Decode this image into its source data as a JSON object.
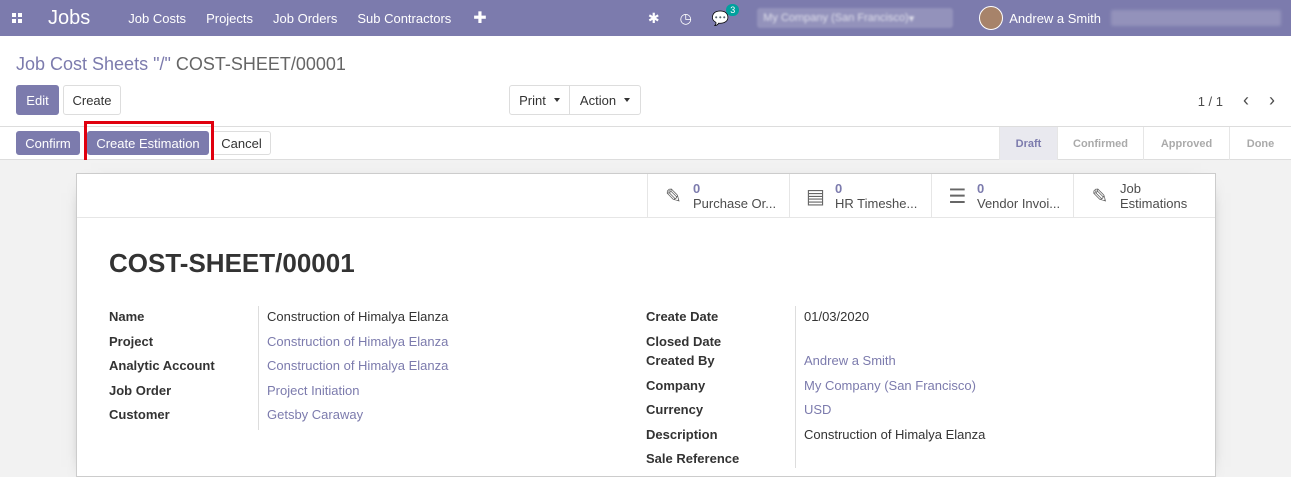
{
  "navbar": {
    "app_title": "Jobs",
    "menu": [
      "Job Costs",
      "Projects",
      "Job Orders",
      "Sub Contractors"
    ],
    "chat_count": "3",
    "company": "My Company (San Francisco)",
    "user": "Andrew a Smith"
  },
  "control": {
    "breadcrumb_parent": "Job Cost Sheets \"/\"",
    "breadcrumb_current": "COST-SHEET/00001",
    "edit_label": "Edit",
    "create_label": "Create",
    "print_label": "Print",
    "action_label": "Action",
    "pager": "1 / 1"
  },
  "statusbar": {
    "confirm_label": "Confirm",
    "create_estimation_label": "Create Estimation",
    "cancel_label": "Cancel",
    "stages": [
      "Draft",
      "Confirmed",
      "Approved",
      "Done"
    ],
    "current_stage": "Draft"
  },
  "smart_buttons": [
    {
      "value": "0",
      "label": "Purchase Or...",
      "icon": "edit-icon"
    },
    {
      "value": "0",
      "label": "HR Timeshe...",
      "icon": "book-icon"
    },
    {
      "value": "0",
      "label": "Vendor Invoi...",
      "icon": "list-icon"
    },
    {
      "value": "",
      "label": "Job Estimations",
      "icon": "edit-icon"
    }
  ],
  "sheet": {
    "title": "COST-SHEET/00001",
    "left_fields": [
      {
        "label": "Name",
        "value": "Construction of Himalya Elanza",
        "link": false
      },
      {
        "label": "Project",
        "value": "Construction of Himalya Elanza",
        "link": true
      },
      {
        "label": "Analytic Account",
        "value": "Construction of Himalya Elanza",
        "link": true
      },
      {
        "label": "Job Order",
        "value": "Project Initiation",
        "link": true
      },
      {
        "label": "Customer",
        "value": "Getsby Caraway",
        "link": true
      }
    ],
    "right_fields": [
      {
        "label": "Create Date",
        "value": "01/03/2020",
        "link": false
      },
      {
        "label": "Closed Date",
        "value": "",
        "link": false
      },
      {
        "label": "Created By",
        "value": "Andrew a Smith",
        "link": true
      },
      {
        "label": "Company",
        "value": "My Company (San Francisco)",
        "link": true
      },
      {
        "label": "Currency",
        "value": "USD",
        "link": true
      },
      {
        "label": "Description",
        "value": "Construction of Himalya Elanza",
        "link": false
      },
      {
        "label": "Sale Reference",
        "value": "",
        "link": false
      }
    ]
  }
}
